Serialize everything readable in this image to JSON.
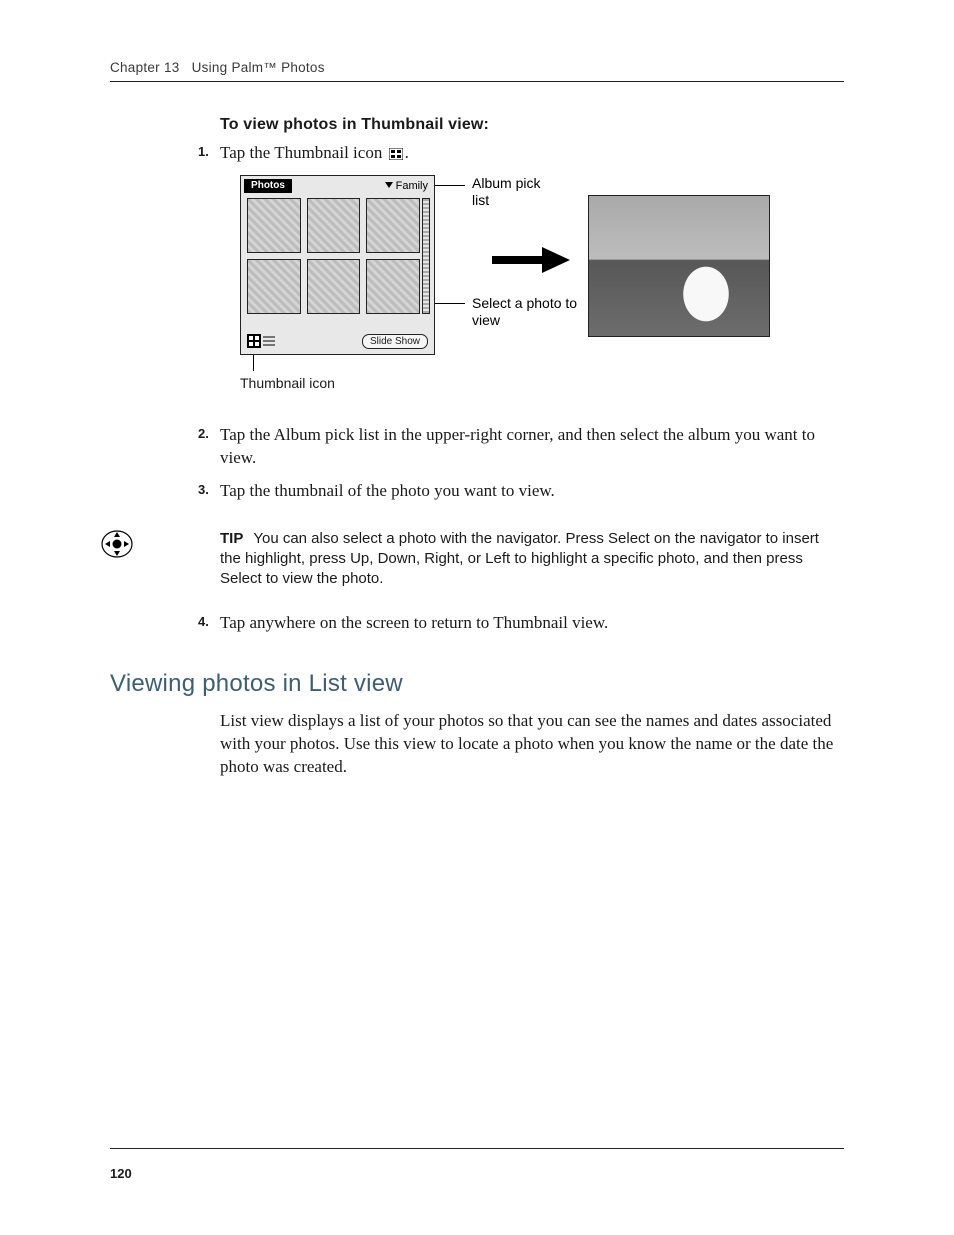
{
  "header": {
    "chapter": "Chapter 13",
    "title": "Using Palm™ Photos"
  },
  "procedure": {
    "heading": "To view photos in Thumbnail view:",
    "steps": [
      {
        "n": "1.",
        "text": "Tap the Thumbnail icon ",
        "after_icon_text": "."
      },
      {
        "n": "2.",
        "text": "Tap the Album pick list in the upper-right corner, and then select the album you want to view."
      },
      {
        "n": "3.",
        "text": "Tap the thumbnail of the photo you want to view."
      },
      {
        "n": "4.",
        "text": "Tap anywhere on the screen to return to Thumbnail view."
      }
    ]
  },
  "figure": {
    "palm_title": "Photos",
    "picklist_label": "Family",
    "slideshow_btn": "Slide Show",
    "callout_album": "Album pick list",
    "callout_select": "Select a photo to view",
    "caption_thumbicon": "Thumbnail icon"
  },
  "tip": {
    "label": "TIP",
    "text": "You can also select a photo with the navigator. Press Select on the navigator to insert the highlight, press Up, Down, Right, or Left to highlight a specific photo, and then press Select to view the photo."
  },
  "section": {
    "heading": "Viewing photos in List view",
    "para": "List view displays a list of your photos so that you can see the names and dates associated with your photos. Use this view to locate a photo when you know the name or the date the photo was created."
  },
  "page_number": "120"
}
